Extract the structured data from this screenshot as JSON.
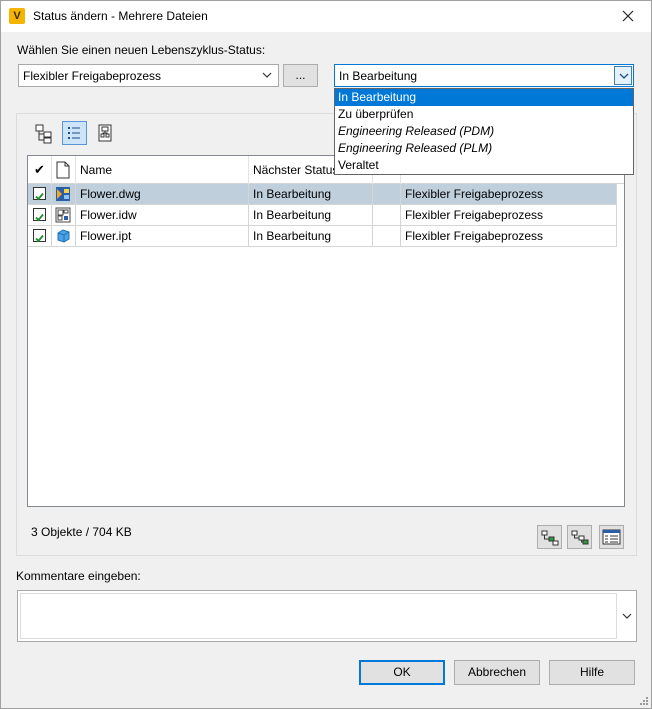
{
  "window": {
    "title": "Status ändern - Mehrere Dateien",
    "app_icon_letter": "V"
  },
  "lifecycle": {
    "prompt": "Wählen Sie einen neuen Lebenszyklus-Status:",
    "definition_value": "Flexibler Freigabeprozess",
    "browse_label": "...",
    "state_value": "In Bearbeitung",
    "state_options": [
      {
        "label": "In Bearbeitung",
        "selected": true,
        "italic": false
      },
      {
        "label": "Zu überprüfen",
        "selected": false,
        "italic": false
      },
      {
        "label": "Engineering Released (PDM)",
        "selected": false,
        "italic": true
      },
      {
        "label": "Engineering Released (PLM)",
        "selected": false,
        "italic": true
      },
      {
        "label": "Veraltet",
        "selected": false,
        "italic": false
      }
    ]
  },
  "grid": {
    "headers": {
      "check": "✔",
      "name": "Name",
      "next_state": "Nächster Status"
    },
    "rows": [
      {
        "name": "Flower.dwg",
        "next_state": "In Bearbeitung",
        "extra": "",
        "lifecycle": "Flexibler Freigabeprozess",
        "checked": true,
        "selected": true,
        "icon": "dwg-file-icon"
      },
      {
        "name": "Flower.idw",
        "next_state": "In Bearbeitung",
        "extra": "",
        "lifecycle": "Flexibler Freigabeprozess",
        "checked": true,
        "selected": false,
        "icon": "idw-file-icon"
      },
      {
        "name": "Flower.ipt",
        "next_state": "In Bearbeitung",
        "extra": "",
        "lifecycle": "Flexibler Freigabeprozess",
        "checked": true,
        "selected": false,
        "icon": "ipt-part-icon"
      }
    ]
  },
  "status": {
    "count": "3 Objekte / 704 KB"
  },
  "comment": {
    "label": "Kommentare eingeben:",
    "value": ""
  },
  "buttons": {
    "ok": "OK",
    "cancel": "Abbrechen",
    "help": "Hilfe"
  },
  "colors": {
    "accent": "#0078d7",
    "selection_row": "#bfcfdc",
    "check_green": "#1e8f2e",
    "app_icon": "#f5b400"
  }
}
